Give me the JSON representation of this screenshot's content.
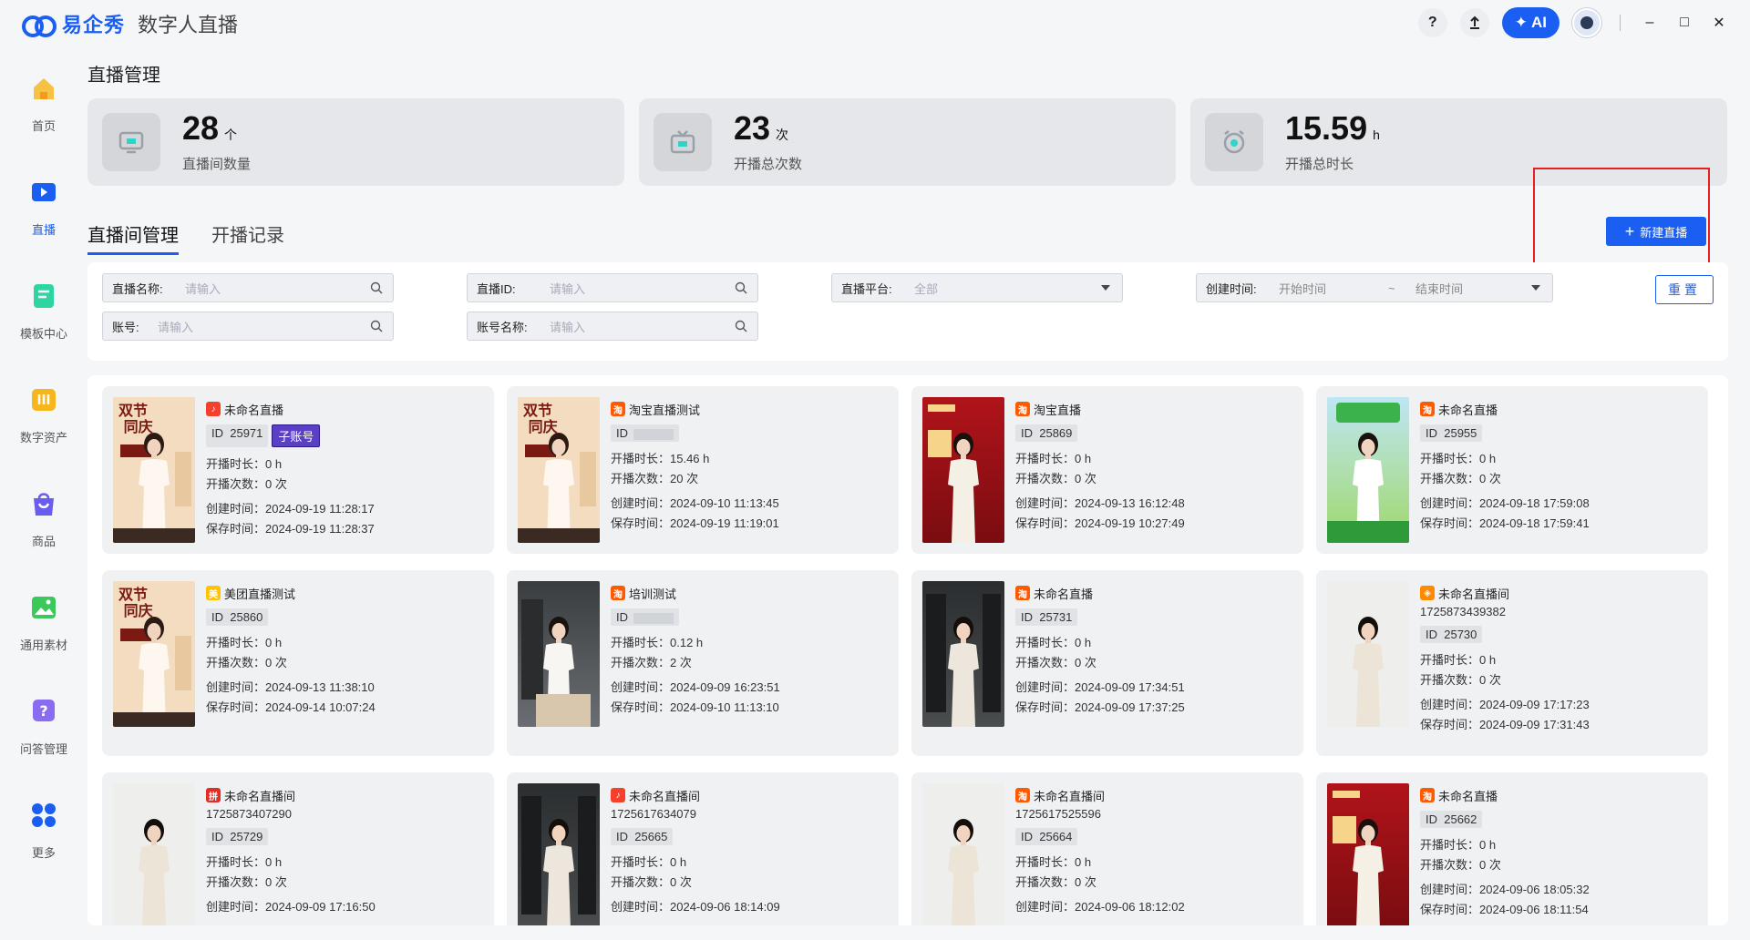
{
  "app": {
    "brand": "易企秀",
    "subtitle": "数字人直播"
  },
  "titlebar": {
    "help": "?",
    "upload": "↑",
    "ai_label": "AI",
    "minimize": "–",
    "maximize": "□",
    "close": "✕"
  },
  "sidebar": {
    "items": [
      {
        "label": "首页",
        "icon": "home-icon",
        "color": "#f5b82e"
      },
      {
        "label": "直播",
        "icon": "live-icon",
        "color": "#1a5ff2",
        "active": true
      },
      {
        "label": "模板中心",
        "icon": "template-icon",
        "color": "#2fd4a3"
      },
      {
        "label": "数字资产",
        "icon": "asset-icon",
        "color": "#f5b82e"
      },
      {
        "label": "商品",
        "icon": "shopping-bag-icon",
        "color": "#6b5cf0"
      },
      {
        "label": "通用素材",
        "icon": "image-icon",
        "color": "#3cc95b"
      },
      {
        "label": "问答管理",
        "icon": "question-icon",
        "color": "#8a6cf0"
      },
      {
        "label": "更多",
        "icon": "more-icon",
        "color": "#1a5ff2"
      }
    ]
  },
  "page": {
    "title": "直播管理"
  },
  "stats": [
    {
      "value": "28",
      "unit": "个",
      "label": "直播间数量",
      "icon": "monitor-icon"
    },
    {
      "value": "23",
      "unit": "次",
      "label": "开播总次数",
      "icon": "tv-icon"
    },
    {
      "value": "15.59",
      "unit": "h",
      "label": "开播总时长",
      "icon": "clock-icon"
    }
  ],
  "tabs": [
    {
      "label": "直播间管理",
      "active": true
    },
    {
      "label": "开播记录"
    }
  ],
  "new_button": {
    "label": "新建直播"
  },
  "filters": {
    "name": {
      "label": "直播名称:",
      "placeholder": "请输入"
    },
    "id": {
      "label": "直播ID:",
      "placeholder": "请输入"
    },
    "platform": {
      "label": "直播平台:",
      "value": "全部"
    },
    "created": {
      "label": "创建时间:",
      "start": "开始时间",
      "sep": "~",
      "end": "结束时间"
    },
    "account": {
      "label": "账号:",
      "placeholder": "请输入"
    },
    "account_name": {
      "label": "账号名称:",
      "placeholder": "请输入"
    },
    "reset": "重置"
  },
  "cards": [
    {
      "name": "未命名直播",
      "platform": "douyin",
      "id": "25971",
      "sub_badge": "子账号",
      "duration": "开播时长：0 h",
      "count": "开播次数：0 次",
      "created": "创建时间：2024-09-19 11:28:17",
      "saved": "保存时间：2024-09-19 11:28:37",
      "thumb": "poster"
    },
    {
      "name": "淘宝直播测试",
      "platform": "taobao",
      "id_blurred": true,
      "duration": "开播时长：15.46 h",
      "count": "开播次数：20 次",
      "created": "创建时间：2024-09-10 11:13:45",
      "saved": "保存时间：2024-09-19 11:19:01",
      "thumb": "poster"
    },
    {
      "name": "淘宝直播",
      "platform": "taobao",
      "id": "25869",
      "duration": "开播时长：0 h",
      "count": "开播次数：0 次",
      "created": "创建时间：2024-09-13 16:12:48",
      "saved": "保存时间：2024-09-19 10:27:49",
      "thumb": "red"
    },
    {
      "name": "未命名直播",
      "platform": "taobao",
      "id": "25955",
      "duration": "开播时长：0 h",
      "count": "开播次数：0 次",
      "created": "创建时间：2024-09-18 17:59:08",
      "saved": "保存时间：2024-09-18 17:59:41",
      "thumb": "spring"
    },
    {
      "name": "美团直播测试",
      "platform": "meituan",
      "id": "25860",
      "duration": "开播时长：0 h",
      "count": "开播次数：0 次",
      "created": "创建时间：2024-09-13 11:38:10",
      "saved": "保存时间：2024-09-14 10:07:24",
      "thumb": "poster"
    },
    {
      "name": "培训测试",
      "platform": "taobao",
      "id_blurred": true,
      "duration": "开播时长：0.12 h",
      "count": "开播次数：2 次",
      "created": "创建时间：2024-09-09 16:23:51",
      "saved": "保存时间：2024-09-10 11:13:10",
      "thumb": "office"
    },
    {
      "name": "未命名直播",
      "platform": "taobao",
      "id": "25731",
      "duration": "开播时长：0 h",
      "count": "开播次数：0 次",
      "created": "创建时间：2024-09-09 17:34:51",
      "saved": "保存时间：2024-09-09 17:37:25",
      "thumb": "dark"
    },
    {
      "name": "未命名直播间",
      "platform": "other",
      "sub_id": "1725873439382",
      "id": "25730",
      "duration": "开播时长：0 h",
      "count": "开播次数：0 次",
      "created": "创建时间：2024-09-09 17:17:23",
      "saved": "保存时间：2024-09-09 17:31:43",
      "thumb": "light"
    },
    {
      "name": "未命名直播间",
      "platform": "pdd",
      "sub_id": "1725873407290",
      "id": "25729",
      "duration": "开播时长：0 h",
      "count": "开播次数：0 次",
      "created": "创建时间：2024-09-09 17:16:50",
      "thumb": "light"
    },
    {
      "name": "未命名直播间",
      "platform": "douyin",
      "sub_id": "1725617634079",
      "id": "25665",
      "duration": "开播时长：0 h",
      "count": "开播次数：0 次",
      "created": "创建时间：2024-09-06 18:14:09",
      "thumb": "dark"
    },
    {
      "name": "未命名直播间",
      "platform": "taobao",
      "sub_id": "1725617525596",
      "id": "25664",
      "duration": "开播时长：0 h",
      "count": "开播次数：0 次",
      "created": "创建时间：2024-09-06 18:12:02",
      "thumb": "light"
    },
    {
      "name": "未命名直播",
      "platform": "taobao",
      "id": "25662",
      "duration": "开播时长：0 h",
      "count": "开播次数：0 次",
      "created": "创建时间：2024-09-06 18:05:32",
      "saved": "保存时间：2024-09-06 18:11:54",
      "thumb": "red"
    }
  ],
  "platform_colors": {
    "douyin": "#f5402c",
    "taobao": "#ff5a00",
    "meituan": "#ffc300",
    "other": "#ff8a00",
    "pdd": "#e02e24"
  },
  "accent": "#1a5ff2"
}
